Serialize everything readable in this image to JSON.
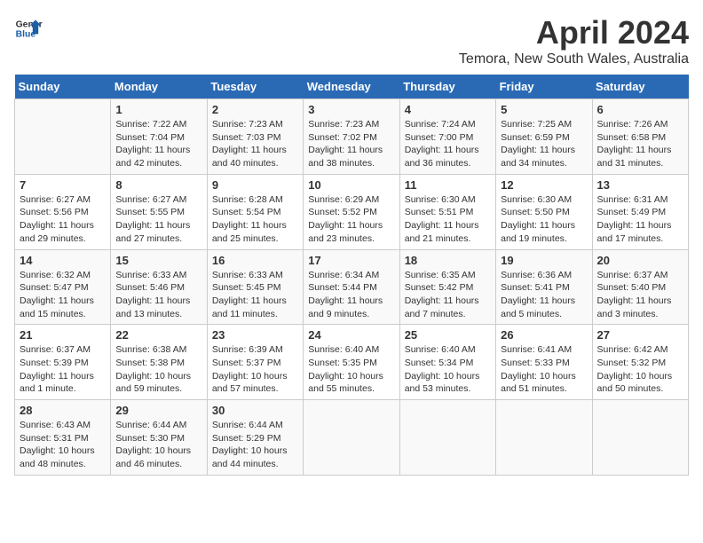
{
  "logo": {
    "line1": "General",
    "line2": "Blue"
  },
  "title": "April 2024",
  "subtitle": "Temora, New South Wales, Australia",
  "weekdays": [
    "Sunday",
    "Monday",
    "Tuesday",
    "Wednesday",
    "Thursday",
    "Friday",
    "Saturday"
  ],
  "weeks": [
    [
      {
        "day": "",
        "info": ""
      },
      {
        "day": "1",
        "info": "Sunrise: 7:22 AM\nSunset: 7:04 PM\nDaylight: 11 hours\nand 42 minutes."
      },
      {
        "day": "2",
        "info": "Sunrise: 7:23 AM\nSunset: 7:03 PM\nDaylight: 11 hours\nand 40 minutes."
      },
      {
        "day": "3",
        "info": "Sunrise: 7:23 AM\nSunset: 7:02 PM\nDaylight: 11 hours\nand 38 minutes."
      },
      {
        "day": "4",
        "info": "Sunrise: 7:24 AM\nSunset: 7:00 PM\nDaylight: 11 hours\nand 36 minutes."
      },
      {
        "day": "5",
        "info": "Sunrise: 7:25 AM\nSunset: 6:59 PM\nDaylight: 11 hours\nand 34 minutes."
      },
      {
        "day": "6",
        "info": "Sunrise: 7:26 AM\nSunset: 6:58 PM\nDaylight: 11 hours\nand 31 minutes."
      }
    ],
    [
      {
        "day": "7",
        "info": "Sunrise: 6:27 AM\nSunset: 5:56 PM\nDaylight: 11 hours\nand 29 minutes."
      },
      {
        "day": "8",
        "info": "Sunrise: 6:27 AM\nSunset: 5:55 PM\nDaylight: 11 hours\nand 27 minutes."
      },
      {
        "day": "9",
        "info": "Sunrise: 6:28 AM\nSunset: 5:54 PM\nDaylight: 11 hours\nand 25 minutes."
      },
      {
        "day": "10",
        "info": "Sunrise: 6:29 AM\nSunset: 5:52 PM\nDaylight: 11 hours\nand 23 minutes."
      },
      {
        "day": "11",
        "info": "Sunrise: 6:30 AM\nSunset: 5:51 PM\nDaylight: 11 hours\nand 21 minutes."
      },
      {
        "day": "12",
        "info": "Sunrise: 6:30 AM\nSunset: 5:50 PM\nDaylight: 11 hours\nand 19 minutes."
      },
      {
        "day": "13",
        "info": "Sunrise: 6:31 AM\nSunset: 5:49 PM\nDaylight: 11 hours\nand 17 minutes."
      }
    ],
    [
      {
        "day": "14",
        "info": "Sunrise: 6:32 AM\nSunset: 5:47 PM\nDaylight: 11 hours\nand 15 minutes."
      },
      {
        "day": "15",
        "info": "Sunrise: 6:33 AM\nSunset: 5:46 PM\nDaylight: 11 hours\nand 13 minutes."
      },
      {
        "day": "16",
        "info": "Sunrise: 6:33 AM\nSunset: 5:45 PM\nDaylight: 11 hours\nand 11 minutes."
      },
      {
        "day": "17",
        "info": "Sunrise: 6:34 AM\nSunset: 5:44 PM\nDaylight: 11 hours\nand 9 minutes."
      },
      {
        "day": "18",
        "info": "Sunrise: 6:35 AM\nSunset: 5:42 PM\nDaylight: 11 hours\nand 7 minutes."
      },
      {
        "day": "19",
        "info": "Sunrise: 6:36 AM\nSunset: 5:41 PM\nDaylight: 11 hours\nand 5 minutes."
      },
      {
        "day": "20",
        "info": "Sunrise: 6:37 AM\nSunset: 5:40 PM\nDaylight: 11 hours\nand 3 minutes."
      }
    ],
    [
      {
        "day": "21",
        "info": "Sunrise: 6:37 AM\nSunset: 5:39 PM\nDaylight: 11 hours\nand 1 minute."
      },
      {
        "day": "22",
        "info": "Sunrise: 6:38 AM\nSunset: 5:38 PM\nDaylight: 10 hours\nand 59 minutes."
      },
      {
        "day": "23",
        "info": "Sunrise: 6:39 AM\nSunset: 5:37 PM\nDaylight: 10 hours\nand 57 minutes."
      },
      {
        "day": "24",
        "info": "Sunrise: 6:40 AM\nSunset: 5:35 PM\nDaylight: 10 hours\nand 55 minutes."
      },
      {
        "day": "25",
        "info": "Sunrise: 6:40 AM\nSunset: 5:34 PM\nDaylight: 10 hours\nand 53 minutes."
      },
      {
        "day": "26",
        "info": "Sunrise: 6:41 AM\nSunset: 5:33 PM\nDaylight: 10 hours\nand 51 minutes."
      },
      {
        "day": "27",
        "info": "Sunrise: 6:42 AM\nSunset: 5:32 PM\nDaylight: 10 hours\nand 50 minutes."
      }
    ],
    [
      {
        "day": "28",
        "info": "Sunrise: 6:43 AM\nSunset: 5:31 PM\nDaylight: 10 hours\nand 48 minutes."
      },
      {
        "day": "29",
        "info": "Sunrise: 6:44 AM\nSunset: 5:30 PM\nDaylight: 10 hours\nand 46 minutes."
      },
      {
        "day": "30",
        "info": "Sunrise: 6:44 AM\nSunset: 5:29 PM\nDaylight: 10 hours\nand 44 minutes."
      },
      {
        "day": "",
        "info": ""
      },
      {
        "day": "",
        "info": ""
      },
      {
        "day": "",
        "info": ""
      },
      {
        "day": "",
        "info": ""
      }
    ]
  ]
}
